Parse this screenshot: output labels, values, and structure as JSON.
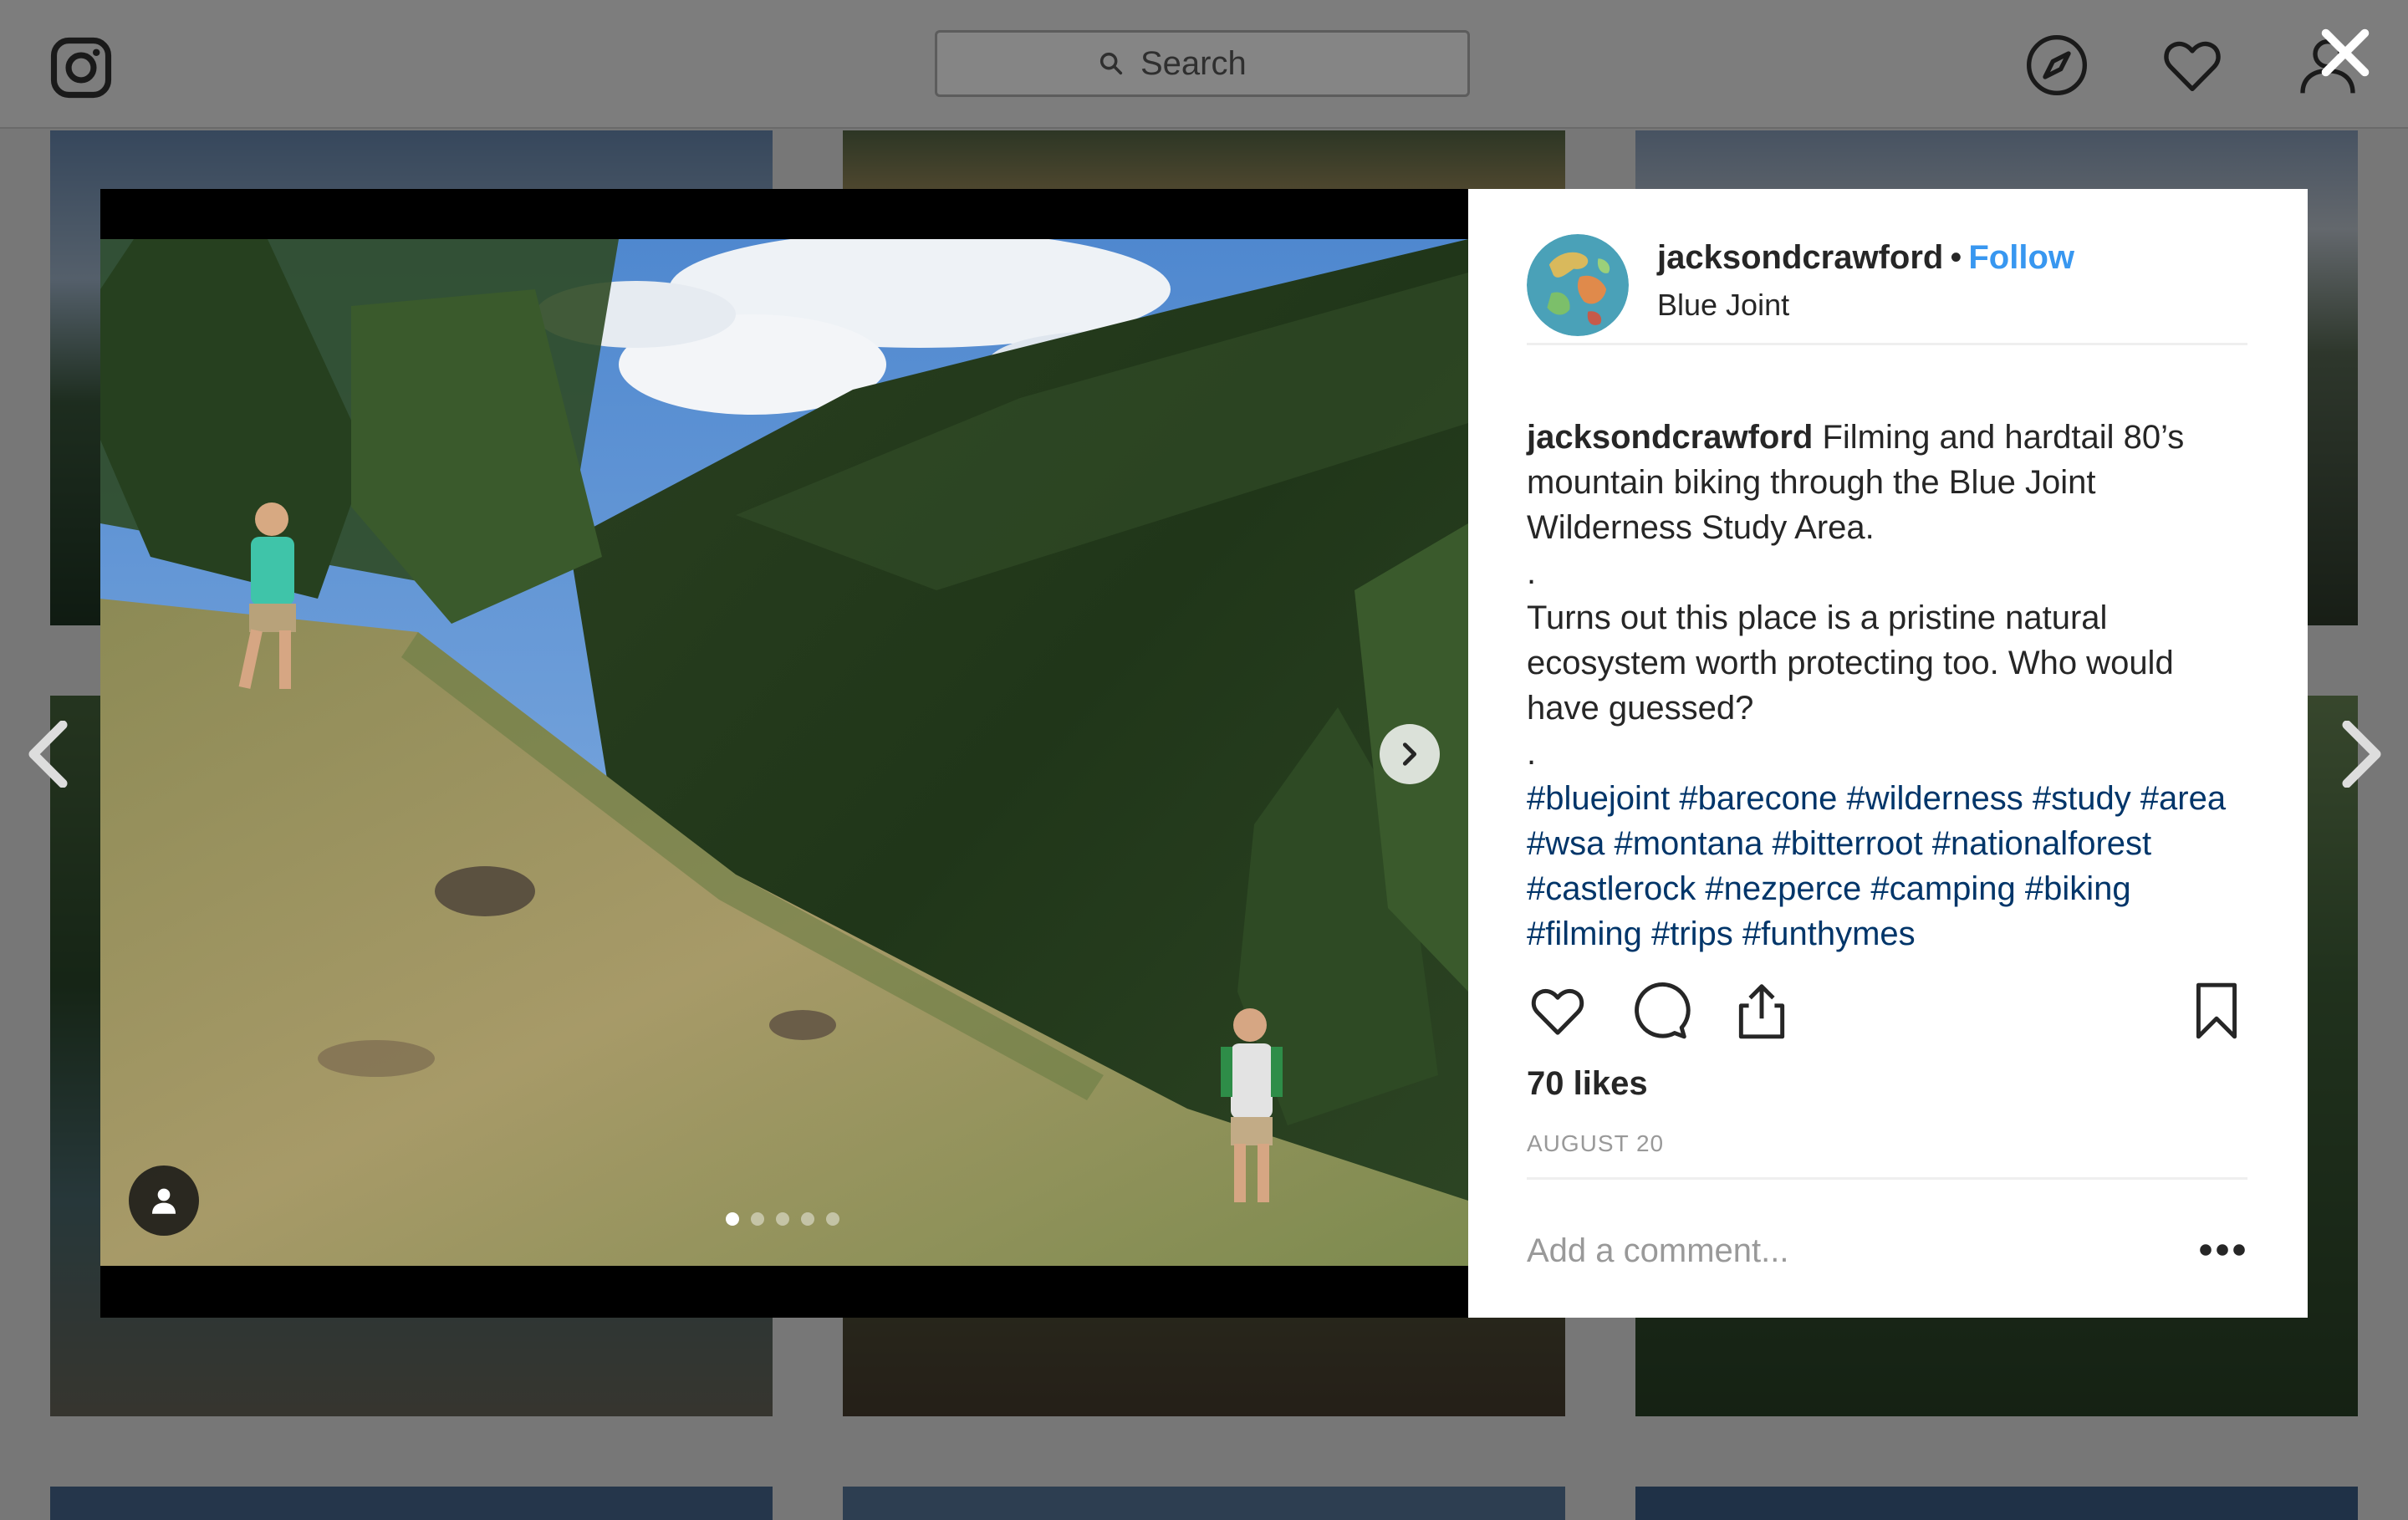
{
  "search": {
    "placeholder": "Search"
  },
  "post": {
    "username": "jacksondcrawford",
    "separator": "•",
    "follow_label": "Follow",
    "location": "Blue Joint",
    "caption": {
      "user": "jacksondcrawford",
      "text1": "Filming and hardtail 80’s mountain biking through the Blue Joint Wilderness Study Area.",
      "dot1": ".",
      "text2": "Turns out this place is a pristine natural ecosystem worth protecting too. Who would have guessed?",
      "dot2": ".",
      "hashtags": "#bluejoint #barecone #wilderness #study #area #wsa #montana #bitterroot #nationalforest #castlerock #nezperce #camping #biking #filming #trips #funthymes"
    },
    "likes": "70 likes",
    "date": "AUGUST 20",
    "comment_placeholder": "Add a comment...",
    "carousel": {
      "count": 5,
      "active_index": 0
    }
  },
  "colors": {
    "follow": "#3897f0",
    "hashtag": "#003569",
    "date": "#999999",
    "overlay": "#777777"
  },
  "icons": {
    "logo": "instagram-logo-icon",
    "search": "search-icon",
    "explore": "compass-icon",
    "activity": "heart-icon",
    "profile": "person-icon",
    "close": "close-icon",
    "like": "heart-icon",
    "comment": "comment-icon",
    "share": "share-icon",
    "save": "bookmark-icon",
    "more": "more-options-icon",
    "next": "chevron-right-icon",
    "prev_post": "chevron-left-icon",
    "next_post": "chevron-right-icon",
    "tags": "user-tag-icon"
  }
}
